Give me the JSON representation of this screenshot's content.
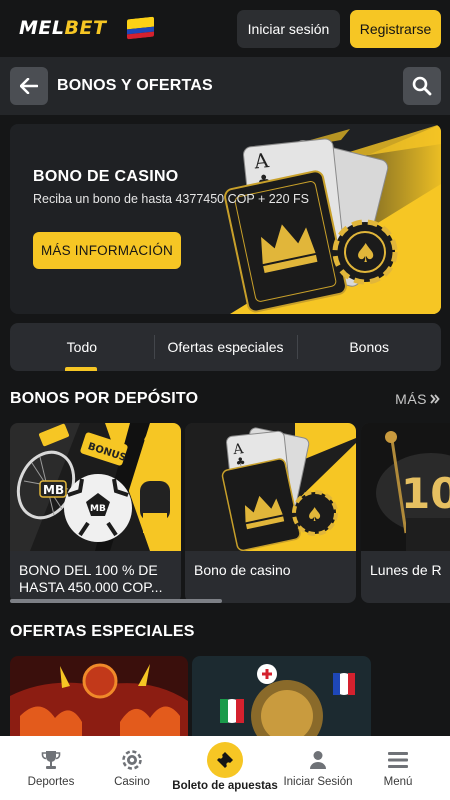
{
  "header": {
    "logo_main": "MEL",
    "logo_accent": "BET",
    "login_label": "Iniciar sesión",
    "register_label": "Registrarse"
  },
  "page": {
    "title": "BONOS Y OFERTAS"
  },
  "hero": {
    "title": "BONO DE CASINO",
    "description": "Reciba un bono de hasta 4377450 COP + 220 FS",
    "button_label": "MÁS INFORMACIÓN"
  },
  "tabs": [
    {
      "label": "Todo",
      "active": true
    },
    {
      "label": "Ofertas especiales",
      "active": false
    },
    {
      "label": "Bonos",
      "active": false
    }
  ],
  "deposit_section": {
    "title": "BONOS POR DEPÓSITO",
    "more_label": "MÁS",
    "cards": [
      {
        "caption": "BONO DEL 100 % DE HASTA 450.000 COP..."
      },
      {
        "caption": "Bono de casino"
      },
      {
        "caption": "Lunes de R"
      }
    ]
  },
  "special_section": {
    "title": "OFERTAS ESPECIALES"
  },
  "bottom_nav": {
    "sports": "Deportes",
    "casino": "Casino",
    "betslip": "Boleto de apuestas",
    "login": "Iniciar Sesión",
    "menu": "Menú"
  },
  "colors": {
    "accent": "#f6c624",
    "background": "#151617",
    "panel": "#2a2c30"
  }
}
